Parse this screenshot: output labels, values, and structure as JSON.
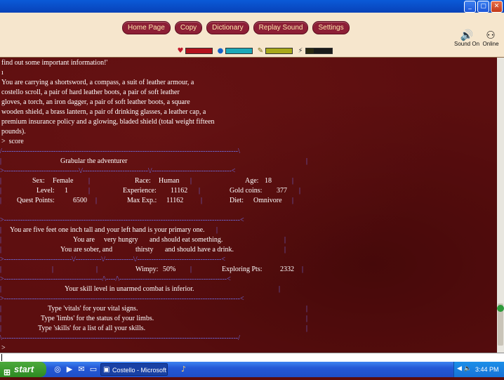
{
  "window": {
    "minimize_icon": "minimize-icon",
    "maximize_icon": "maximize-icon",
    "close_icon": "close-icon"
  },
  "toolbar": {
    "buttons": [
      "Home Page",
      "Copy",
      "Dictionary",
      "Replay Sound",
      "Settings"
    ],
    "sound_label": "Sound On",
    "online_label": "Online",
    "colors": {
      "bg": "#f6e6cd",
      "button": "#8d1f36",
      "button_text": "#ffe9ad"
    }
  },
  "status_bars": [
    {
      "icon": "heart-icon",
      "color": "#b3121d",
      "level": 1.0
    },
    {
      "icon": "water-drop-icon",
      "color": "#1ca8b8",
      "level": 1.0
    },
    {
      "icon": "food-icon",
      "color": "#a8a81a",
      "level": 1.0
    },
    {
      "icon": "stamina-icon",
      "color": "#2a2a12",
      "level": 0.3
    }
  ],
  "game": {
    "intro": [
      "find out some important information!'",
      "ı",
      "You are carrying a shortsword, a compass, a suit of leather armour, a",
      "costello scroll, a pair of hard leather boots, a pair of soft leather",
      "gloves, a torch, an iron dagger, a pair of soft leather boots, a square",
      "wooden shield, a brass lantern, a pair of drinking glasses, a leather cap, a",
      "premium insurance policy and a glowing, bladed shield (total weight fifteen",
      "pounds).",
      ">  score"
    ],
    "title": "Grabular the adventurer",
    "stats": {
      "sex_label": "Sex:",
      "sex": "Female",
      "race_label": "Race:",
      "race": "Human",
      "age_label": "Age:",
      "age": "18",
      "level_label": "Level:",
      "level": "1",
      "exp_label": "Experience:",
      "exp": "11162",
      "gold_label": "Gold coins:",
      "gold": "377",
      "quest_label": "Quest Points:",
      "quest": "6500",
      "maxexp_label": "Max Exp.:",
      "maxexp": "11162",
      "diet_label": "Diet:",
      "diet": "Omnivore"
    },
    "height_line": "You are five feet one inch tall and your left hand is your primary one.",
    "hunger_pre": "You are",
    "hunger_word": "very hungry",
    "hunger_post": "and should eat something.",
    "sober_pre": "You are sober, and",
    "thirst_word": "thirsty",
    "thirst_post": "and should have a drink.",
    "wimpy_label": "Wimpy:",
    "wimpy": "50%",
    "explore_label": "Exploring Pts:",
    "explore": "2332",
    "skill_line": "Your skill level in unarmed combat is inferior.",
    "help": [
      "Type 'vitals' for your vital signs.",
      "Type 'limbs' for the status of your limbs.",
      "Type 'skills' for a list of all your skills."
    ],
    "prompt": ">"
  },
  "taskbar": {
    "start": "start",
    "task": "Costello - Microsoft ...",
    "clock": "3:44 PM"
  }
}
